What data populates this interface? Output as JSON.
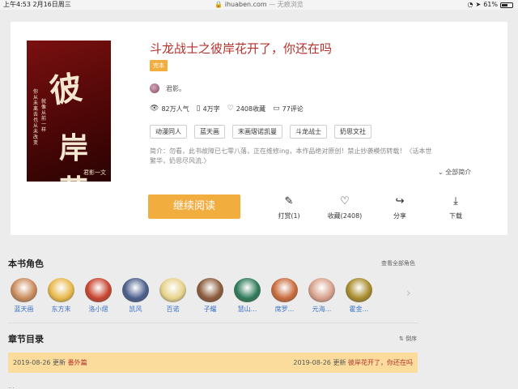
{
  "status_bar": {
    "time_date": "上午4:53   2月16日周三",
    "url": "ihuaben.com",
    "mode": " — 无痕浏览",
    "battery": "61%",
    "battery_level": 0.61
  },
  "book": {
    "title": "斗龙战士之彼岸花开了，你还在吗",
    "status_badge": "完本",
    "author": "君影。",
    "popularity": "82万人气",
    "word_count": "4万字",
    "favorites": "2408收藏",
    "comments": "77评论",
    "tags": [
      "动漫同人",
      "蓝天画",
      "末画熠诺凯曼",
      "斗龙战士",
      "奶思文社"
    ],
    "intro": "简介：勿看，此书故障已七零八落，正在维修ing，本作品绝对原创！禁止抄袭模仿转载！〈话本世繁华，奶思尽风流.〉",
    "expand_label": "全部简介",
    "read_button": "继续阅读",
    "actions": {
      "tip": "打赏(1)",
      "favorite": "收藏(2408)",
      "share": "分享",
      "download": "下载"
    }
  },
  "characters": {
    "title": "本书角色",
    "view_all": "查看全部角色",
    "items": [
      {
        "name": "蓝天画",
        "color": "#c98a5a"
      },
      {
        "name": "东方末",
        "color": "#e8b84a"
      },
      {
        "name": "洛小熠",
        "color": "#c8442e"
      },
      {
        "name": "凯风",
        "color": "#4a5e8c"
      },
      {
        "name": "百诺",
        "color": "#e6d28a"
      },
      {
        "name": "子耀",
        "color": "#8a5a3a"
      },
      {
        "name": "慧山...",
        "color": "#2e7a5a"
      },
      {
        "name": "席罗...",
        "color": "#c86a3a"
      },
      {
        "name": "元海...",
        "color": "#d8a08a"
      },
      {
        "name": "霍金...",
        "color": "#a88a2a"
      }
    ]
  },
  "chapters": {
    "title": "章节目录",
    "order_label": "倒序",
    "left_date": "2019-08-26",
    "left_update": "更新",
    "left_name": "番外篇",
    "right_date": "2019-08-26",
    "right_update": "更新",
    "right_name": "彼岸花开了，你还在吗",
    "peek_text": "..."
  },
  "cover": {
    "glyph1": "彼",
    "glyph2": "岸花",
    "vertical_left": "你从未离去 也从未改变",
    "vertical_mid": "就像从前一样",
    "footer": "君影一文"
  }
}
